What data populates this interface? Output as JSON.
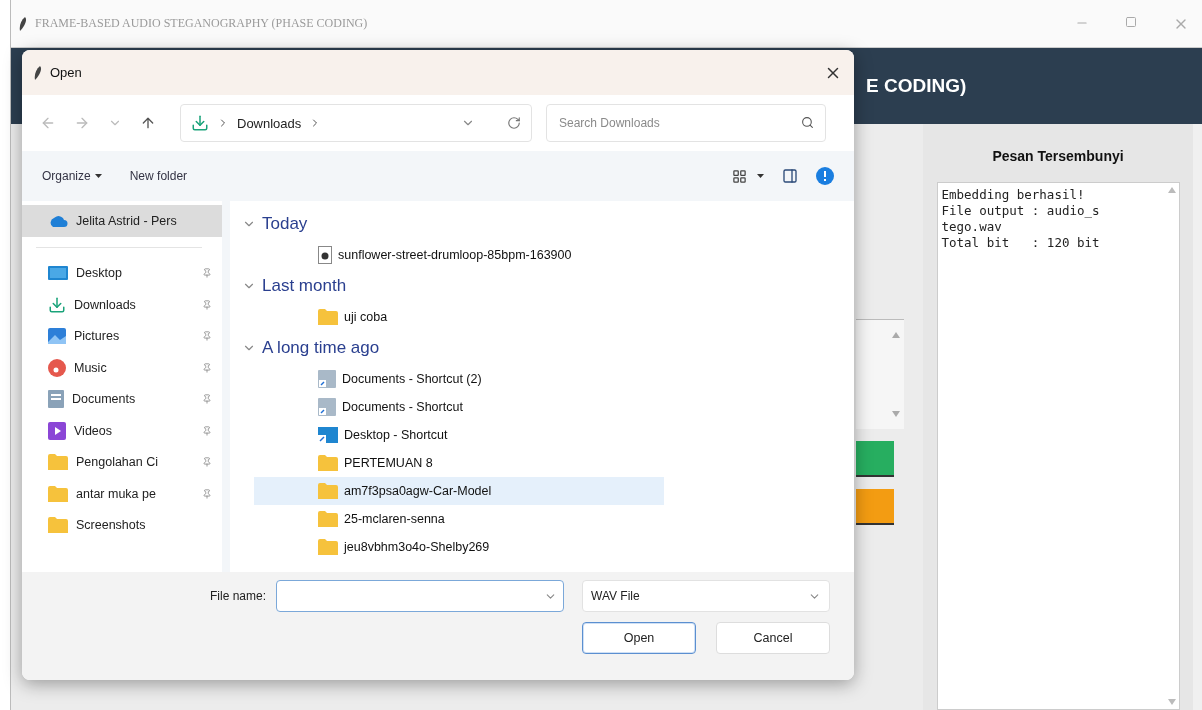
{
  "window": {
    "title": "FRAME-BASED AUDIO STEGANOGRAPHY (PHASE CODING)"
  },
  "header": {
    "title": "E CODING)"
  },
  "side_panel": {
    "title": "Pesan Tersembunyi",
    "lines": [
      "Embedding berhasil!",
      "File output : audio_s",
      "tego.wav",
      "Total bit   : 120 bit"
    ]
  },
  "dialog": {
    "title": "Open",
    "address": {
      "location": "Downloads"
    },
    "search": {
      "placeholder": "Search Downloads"
    },
    "commands": [
      {
        "label": "Organize",
        "kind": "menu"
      },
      {
        "label": "New folder",
        "kind": "plain"
      }
    ],
    "sidebar": [
      {
        "label": "Jelita Astrid - Pers",
        "kind": "cloud",
        "pinned": false,
        "selected": true
      },
      {
        "label": "Desktop",
        "kind": "desktop",
        "pinned": true,
        "selected": false
      },
      {
        "label": "Downloads",
        "kind": "downloads",
        "pinned": true,
        "selected": false
      },
      {
        "label": "Pictures",
        "kind": "pictures",
        "pinned": true,
        "selected": false
      },
      {
        "label": "Music",
        "kind": "music",
        "pinned": true,
        "selected": false
      },
      {
        "label": "Documents",
        "kind": "documents",
        "pinned": true,
        "selected": false
      },
      {
        "label": "Videos",
        "kind": "videos",
        "pinned": true,
        "selected": false
      },
      {
        "label": "Pengolahan Ci",
        "kind": "folder",
        "pinned": true,
        "selected": false
      },
      {
        "label": "antar muka pe",
        "kind": "folder",
        "pinned": true,
        "selected": false
      },
      {
        "label": "Screenshots",
        "kind": "folder",
        "pinned": false,
        "selected": false
      }
    ],
    "groups": [
      {
        "label": "Today",
        "expanded": true,
        "children": [
          {
            "label": "sunflower-street-drumloop-85bpm-163900",
            "kind": "audio",
            "selected": false
          }
        ]
      },
      {
        "label": "Last month",
        "expanded": true,
        "children": [
          {
            "label": "uji coba",
            "kind": "folder",
            "selected": false
          }
        ]
      },
      {
        "label": "A long time ago",
        "expanded": true,
        "children": [
          {
            "label": "Documents - Shortcut (2)",
            "kind": "doc-shortcut",
            "selected": false
          },
          {
            "label": "Documents - Shortcut",
            "kind": "doc-shortcut",
            "selected": false
          },
          {
            "label": "Desktop - Shortcut",
            "kind": "desktop-shortcut",
            "selected": false
          },
          {
            "label": "PERTEMUAN 8",
            "kind": "folder",
            "selected": false
          },
          {
            "label": "am7f3psa0agw-Car-Model",
            "kind": "folder",
            "selected": true
          },
          {
            "label": "25-mclaren-senna",
            "kind": "folder",
            "selected": false
          },
          {
            "label": "jeu8vbhm3o4o-Shelby269",
            "kind": "folder",
            "selected": false
          }
        ]
      }
    ],
    "file_name": {
      "label": "File name:"
    },
    "file_type": {
      "value": "WAV File"
    },
    "buttons": [
      {
        "label": "Open",
        "kind": "primary"
      },
      {
        "label": "Cancel",
        "kind": "secondary"
      }
    ]
  }
}
